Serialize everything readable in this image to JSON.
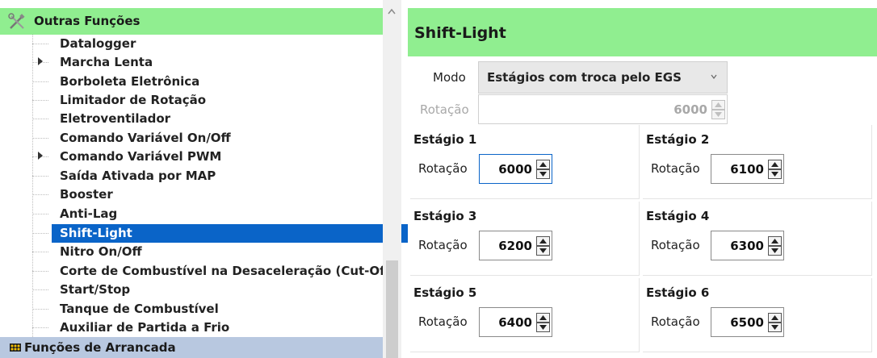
{
  "tree": {
    "group_label": "Outras Funções",
    "items": [
      {
        "label": "Datalogger",
        "expandable": false
      },
      {
        "label": "Marcha Lenta",
        "expandable": true
      },
      {
        "label": "Borboleta Eletrônica",
        "expandable": false
      },
      {
        "label": "Limitador de Rotação",
        "expandable": false
      },
      {
        "label": "Eletroventilador",
        "expandable": false
      },
      {
        "label": "Comando Variável On/Off",
        "expandable": false
      },
      {
        "label": "Comando Variável PWM",
        "expandable": true
      },
      {
        "label": "Saída Ativada por MAP",
        "expandable": false
      },
      {
        "label": "Booster",
        "expandable": false
      },
      {
        "label": "Anti-Lag",
        "expandable": false
      },
      {
        "label": "Shift-Light",
        "expandable": false,
        "selected": true
      },
      {
        "label": "Nitro On/Off",
        "expandable": false
      },
      {
        "label": "Corte de Combustível na Desaceleração (Cut-Off)",
        "expandable": false
      },
      {
        "label": "Start/Stop",
        "expandable": false
      },
      {
        "label": "Tanque de Combustível",
        "expandable": false
      },
      {
        "label": "Auxiliar de Partida a Frio",
        "expandable": false
      }
    ],
    "next_group_label": "Funções de Arrancada"
  },
  "panel": {
    "title": "Shift-Light",
    "mode_label": "Modo",
    "mode_value": "Estágios com troca pelo EGS",
    "rotation_label": "Rotação",
    "rotation_value": "6000",
    "stages": [
      {
        "title": "Estágio 1",
        "label": "Rotação",
        "value": "6000"
      },
      {
        "title": "Estágio 2",
        "label": "Rotação",
        "value": "6100"
      },
      {
        "title": "Estágio 3",
        "label": "Rotação",
        "value": "6200"
      },
      {
        "title": "Estágio 4",
        "label": "Rotação",
        "value": "6300"
      },
      {
        "title": "Estágio 5",
        "label": "Rotação",
        "value": "6400"
      },
      {
        "title": "Estágio 6",
        "label": "Rotação",
        "value": "6500"
      }
    ]
  },
  "colors": {
    "header_green": "#90ee90",
    "selection_blue": "#0a64c8",
    "footer_group_blue": "#b8c8e0"
  }
}
